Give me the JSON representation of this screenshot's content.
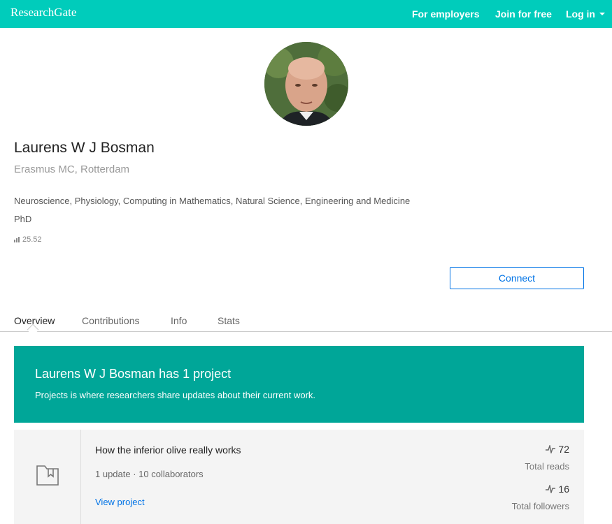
{
  "header": {
    "logo": "ResearchGate",
    "nav": {
      "employers": "For employers",
      "join": "Join for free",
      "login": "Log in"
    },
    "bg_color": "#00ccbb"
  },
  "profile": {
    "name": "Laurens W J Bosman",
    "institution": "Erasmus MC, Rotterdam",
    "disciplines": "Neuroscience, Physiology, Computing in Mathematics, Natural Science, Engineering and Medicine",
    "degree": "PhD",
    "rg_score": "25.52",
    "connect_label": "Connect"
  },
  "tabs": [
    {
      "label": "Overview",
      "active": true
    },
    {
      "label": "Contributions",
      "active": false
    },
    {
      "label": "Info",
      "active": false
    },
    {
      "label": "Stats",
      "active": false
    }
  ],
  "banner": {
    "title": "Laurens W J Bosman has 1 project",
    "subtitle": "Projects is where researchers share updates about their current work.",
    "bg_color": "#00a698"
  },
  "project": {
    "icon": "project-folder-icon",
    "title": "How the inferior olive really works",
    "meta": "1 update · 10 collaborators",
    "link_label": "View project",
    "reads": {
      "value": "72",
      "label": "Total reads"
    },
    "followers": {
      "value": "16",
      "label": "Total followers"
    }
  },
  "colors": {
    "accent": "#00ccbb",
    "link": "#0073e6"
  }
}
